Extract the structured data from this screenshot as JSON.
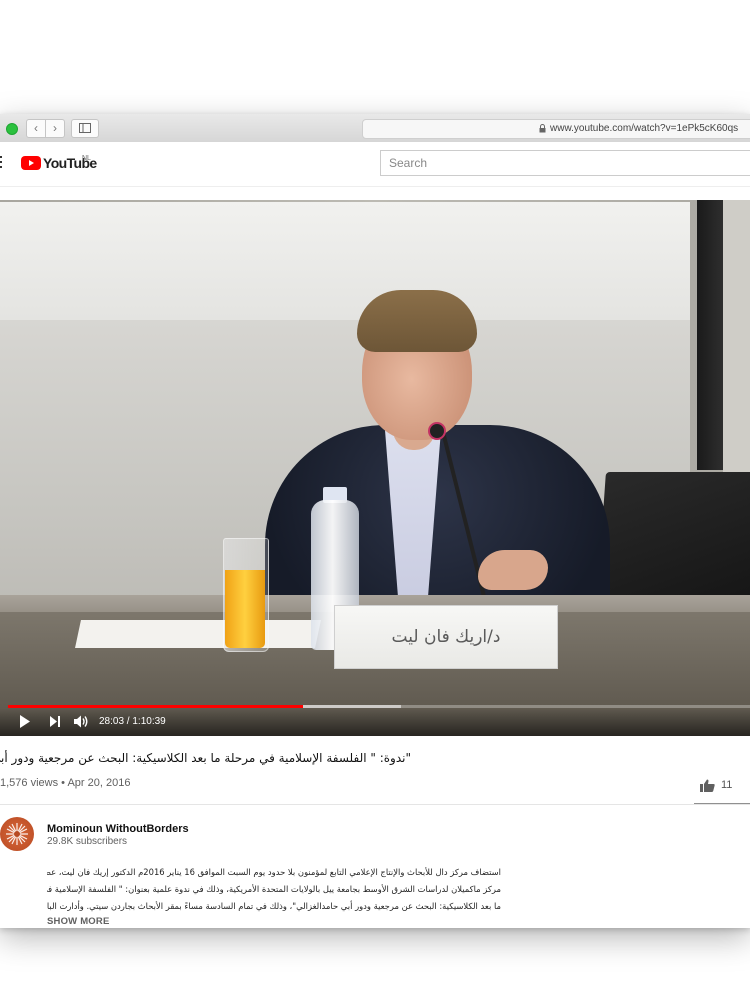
{
  "browser": {
    "url": "www.youtube.com/watch?v=1ePk5cK60qs"
  },
  "header": {
    "logo_text": "YouTube",
    "region": "NL",
    "search_placeholder": "Search"
  },
  "player": {
    "time": "28:03 / 1:10:39",
    "progress": 0.397,
    "buffered": 0.53,
    "nameplate_text": "د/اريك فان ليت"
  },
  "video": {
    "title": "\"ندوة: \" الفلسفة الإسلامية في مرحلة ما بعد الكلاسيكية: البحث عن مرجعية ودور أبي حامد الغزالي",
    "meta": "1,576 views • Apr 20, 2016",
    "likes": "11"
  },
  "channel": {
    "name": "Mominoun WithoutBorders",
    "subscribers": "29.8K subscribers"
  },
  "description": {
    "lines": [
      "استضاف مركز دال للأبحاث والإنتاج الإعلامي التابع لمؤمنون بلا حدود يوم السبت الموافق 16 يناير 2016م الدكتور إريك فان ليت، عضو",
      "مركز ماكميلان لدراسات الشرق الأوسط بجامعة ييل بالولايات المتحدة الأمريكية، وذلك في ندوة علمية بعنوان: \" الفلسفة الإسلامية في مرحلة",
      "ما بعد الكلاسيكية: البحث عن مرجعية ودور أبي حامدالغزالي\"، وذلك في تمام السادسة مساءً بمقر الأبحاث بجاردن سيتي. وأدارت الباحثة"
    ],
    "show_more": "SHOW MORE"
  }
}
